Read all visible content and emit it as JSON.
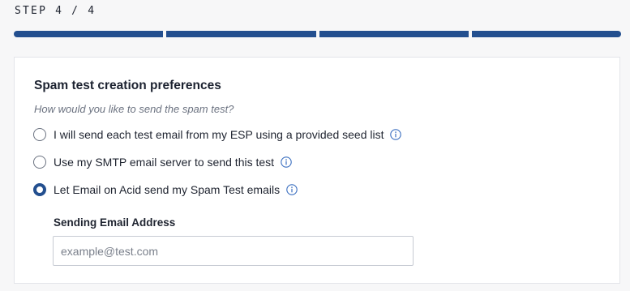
{
  "step": {
    "label": "STEP 4 / 4",
    "segments_completed": 4,
    "segments_total": 4
  },
  "colors": {
    "accent": "#234f8f",
    "info_icon": "#3b6fc0"
  },
  "card": {
    "title": "Spam test creation preferences",
    "subtitle": "How would you like to send the spam test?",
    "options": [
      {
        "label": "I will send each test email from my ESP using a provided seed list",
        "selected": false,
        "icon": "info-icon"
      },
      {
        "label": "Use my SMTP email server to send this test",
        "selected": false,
        "icon": "info-icon"
      },
      {
        "label": "Let Email on Acid send my Spam Test emails",
        "selected": true,
        "icon": "info-icon"
      }
    ],
    "sending_email": {
      "label": "Sending Email Address",
      "placeholder": "example@test.com",
      "value": ""
    }
  }
}
